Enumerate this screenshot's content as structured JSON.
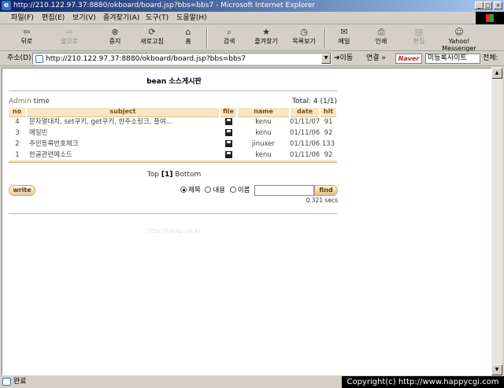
{
  "window": {
    "title": "http://210.122.97.37:8880/okboard/board.jsp?bbs=bbs7 - Microsoft Internet Explorer",
    "min_label": "_",
    "max_label": "□",
    "close_label": "×"
  },
  "menu": {
    "items": [
      "파일(F)",
      "편집(E)",
      "보기(V)",
      "즐겨찾기(A)",
      "도구(T)",
      "도움말(H)"
    ]
  },
  "toolbar": {
    "back": "뒤로",
    "forward": "앞으로",
    "stop": "중지",
    "refresh": "새로고침",
    "home": "홈",
    "search": "검색",
    "favorites": "즐겨찾기",
    "history": "목록보기",
    "mail": "메일",
    "print": "인쇄",
    "edit": "편집",
    "yahoo_1": "Yahoo!",
    "yahoo_2": "Messenger"
  },
  "address": {
    "label": "주소(D)",
    "url": "http://210.122.97.37:8880/okboard/board.jsp?bbs=bbs7",
    "go": "이동",
    "links": "연결 »",
    "naver": "Naver",
    "ext1": "미등록사이트",
    "ext2": "전체:"
  },
  "board": {
    "title": "bean 소스게시판",
    "admin_label": "Admin",
    "time_label": "time",
    "total": "Total: 4 (1/1)",
    "columns": {
      "no": "no",
      "subject": "subject",
      "file": "file",
      "name": "name",
      "date": "date",
      "hit": "hit"
    },
    "rows": [
      {
        "no": "4",
        "subject": "문자열대치, set쿠키, get쿠키, 한주소링크, 플여...",
        "name": "kenu",
        "date": "01/11/07",
        "hit": "91"
      },
      {
        "no": "3",
        "subject": "메일빈",
        "name": "kenu",
        "date": "01/11/06",
        "hit": "92"
      },
      {
        "no": "2",
        "subject": "주민등록번호체크",
        "name": "jinuxer",
        "date": "01/11/06",
        "hit": "133"
      },
      {
        "no": "1",
        "subject": "한글관련메소드",
        "name": "kenu",
        "date": "01/11/06",
        "hit": "92"
      }
    ],
    "pager": {
      "top": "Top",
      "current": "[1]",
      "bottom": "Bottom"
    },
    "write": "write",
    "search_options": [
      "제목",
      "내용",
      "이름"
    ],
    "find": "find",
    "elapsed": "0.321 secs",
    "footer_url": "http://okjsp.pe.kr"
  },
  "status": {
    "text": "완료",
    "copyright": "Copyright(c) http://www.happycgi.com"
  }
}
